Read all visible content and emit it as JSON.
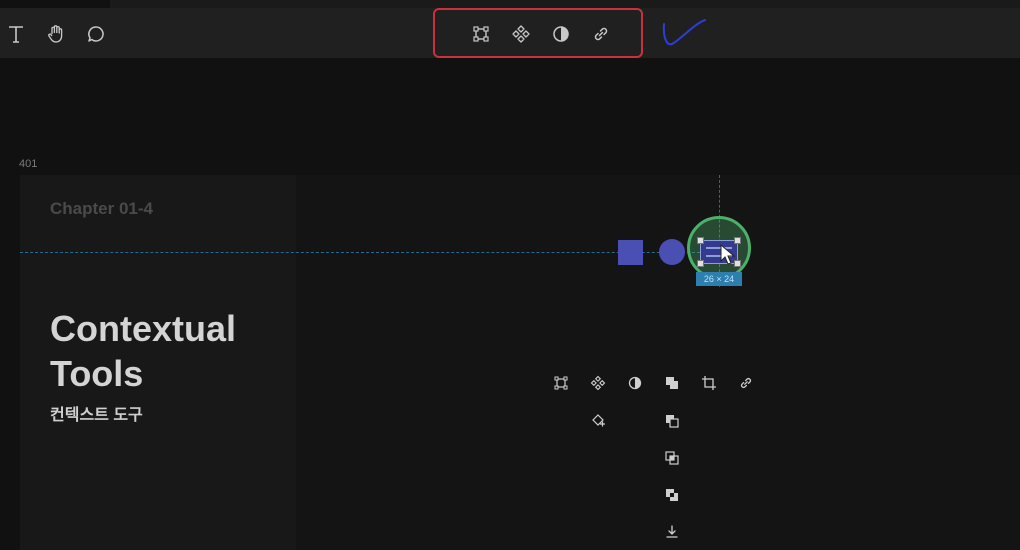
{
  "toolbar": {
    "left_tools": [
      {
        "name": "text-tool",
        "icon": "text-icon"
      },
      {
        "name": "hand-tool",
        "icon": "hand-icon"
      },
      {
        "name": "comment-tool",
        "icon": "comment-icon"
      }
    ],
    "contextual_tools": [
      {
        "name": "vector-edit",
        "icon": "vector-path-icon"
      },
      {
        "name": "create-component",
        "icon": "component-icon"
      },
      {
        "name": "mask",
        "icon": "mask-icon"
      },
      {
        "name": "link",
        "icon": "link-icon"
      }
    ],
    "highlight_color": "#c8323c",
    "annotation_color": "#2a3fd6"
  },
  "canvas": {
    "frame_label": "401",
    "chapter": "Chapter 01-4",
    "title_line1": "Contextual",
    "title_line2": "Tools",
    "subtitle": "컨텍스트 도구",
    "size_badge": "26 × 24"
  },
  "context_panel": {
    "icons": [
      "vector-path-icon",
      "component-icon",
      "mask-icon",
      "boolean-icon",
      "crop-icon",
      "link-icon",
      "component-add-icon",
      "union-icon",
      "subtract-icon",
      "intersect-icon",
      "flatten-icon"
    ]
  },
  "colors": {
    "shape_fill": "#4a4fb3",
    "selection_ring": "#4caf6a",
    "guide": "#2b6a8f"
  }
}
